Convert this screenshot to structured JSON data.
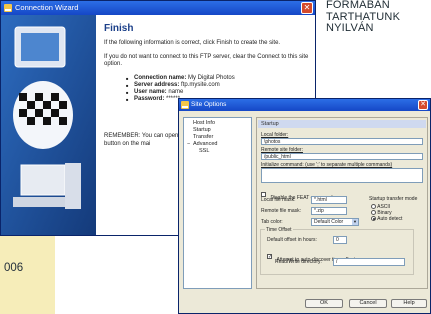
{
  "background": {
    "magazine_lines": [
      "FORMÁBAN",
      "TARTHATUNK",
      "NYILVÁN"
    ],
    "side_number": "006"
  },
  "wizard": {
    "title": "Connection Wizard",
    "close_label": "✕",
    "heading": "Finish",
    "intro": "If the following information is correct, click Finish to create the site.",
    "note": "If you do not want to connect to this FTP server, clear the Connect to this site option.",
    "details": [
      {
        "key": "Connection name:",
        "value": "My Digital Photos"
      },
      {
        "key": "Server address:",
        "value": "ftp.mysite.com"
      },
      {
        "key": "User name:",
        "value": "name"
      },
      {
        "key": "Password:",
        "value": "******"
      }
    ],
    "remember": "REMEMBER: You can open Connect button on the mai"
  },
  "site_options": {
    "title": "Site Options",
    "close_label": "✕",
    "tree": [
      "Host Info",
      "Startup",
      "Transfer",
      "Advanced",
      "SSL"
    ],
    "tree_expand": "−",
    "panel_title": "Startup",
    "local_folder_label": "Local folder:",
    "local_folder_value": "\\photos",
    "remote_folder_label": "Remote site folder:",
    "remote_folder_value": "/public_html",
    "init_command_label": "Initialize command: (use ';' to separate multiple commands)",
    "init_command_value": "",
    "disable_feat_label": "Disable the FEAT command",
    "local_mask_label": "Local file mask:",
    "local_mask_value": "*.html",
    "remote_mask_label": "Remote file mask:",
    "remote_mask_value": "*.zip",
    "tab_color_label": "Tab color:",
    "tab_color_value": "Default Color",
    "transfer_mode_label": "Startup transfer mode",
    "transfer_modes": [
      "ASCII",
      "Binary",
      "Auto detect"
    ],
    "time_offset_label": "Time Offset",
    "default_offset_label": "Default offset in hours:",
    "default_offset_value": "0",
    "auto_discover_label": "Attempt to auto-discover time offset.",
    "readwrite_label": "Read/Write directory:",
    "readwrite_value": "/",
    "ok_label": "OK",
    "cancel_label": "Cancel",
    "help_label": "Help",
    "dropdown_arrow": "▼"
  },
  "colors": {
    "titlebar": "#1e55d6",
    "close": "#d54a2b",
    "window_bg": "#ece9d8",
    "magazine_strip": "#f6edb9"
  }
}
